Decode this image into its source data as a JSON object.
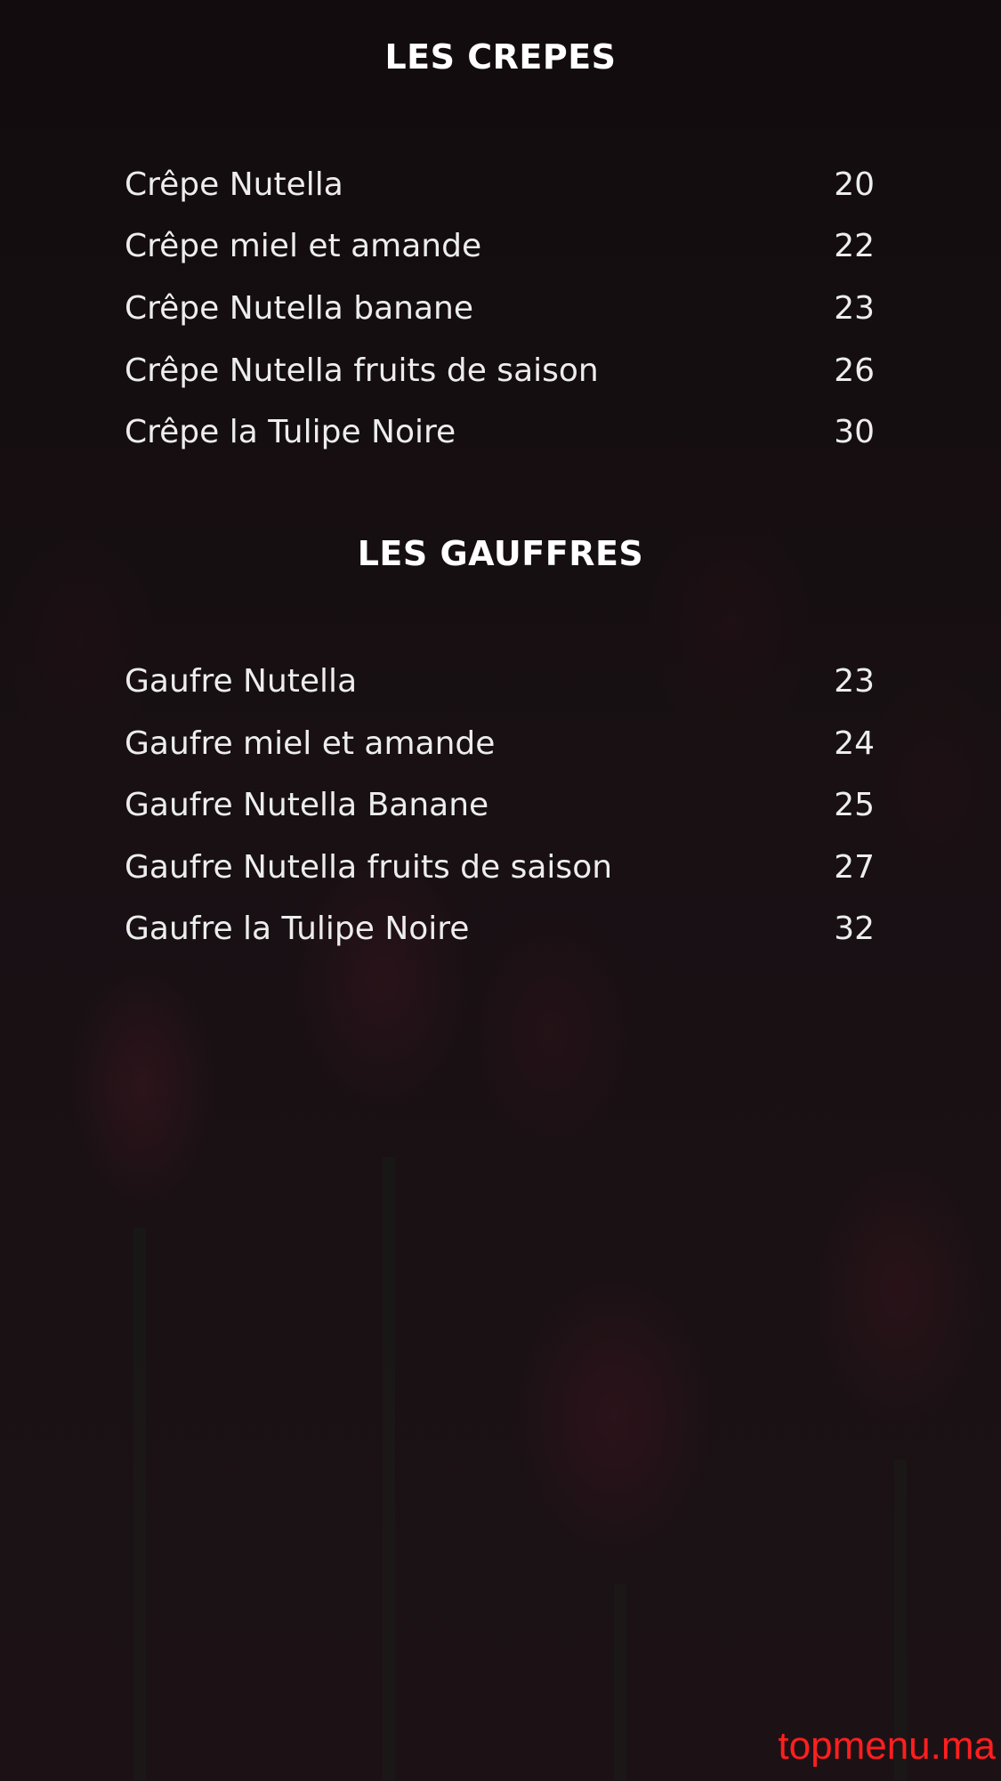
{
  "sections": [
    {
      "title": "LES CREPES",
      "items": [
        {
          "name": "Crêpe Nutella",
          "price": "20"
        },
        {
          "name": "Crêpe miel et amande",
          "price": "22"
        },
        {
          "name": "Crêpe Nutella banane",
          "price": "23"
        },
        {
          "name": "Crêpe Nutella fruits de saison",
          "price": "26"
        },
        {
          "name": "Crêpe la Tulipe Noire",
          "price": "30"
        }
      ]
    },
    {
      "title": "LES GAUFFRES",
      "items": [
        {
          "name": "Gaufre Nutella",
          "price": "23"
        },
        {
          "name": "Gaufre miel et amande",
          "price": "24"
        },
        {
          "name": "Gaufre Nutella Banane",
          "price": "25"
        },
        {
          "name": "Gaufre Nutella fruits de saison",
          "price": "27"
        },
        {
          "name": "Gaufre la Tulipe Noire",
          "price": "32"
        }
      ]
    }
  ],
  "watermark": "topmenu.ma",
  "colors": {
    "background": "#160f12",
    "text": "#ffffff",
    "watermark": "#ff1f1f"
  }
}
